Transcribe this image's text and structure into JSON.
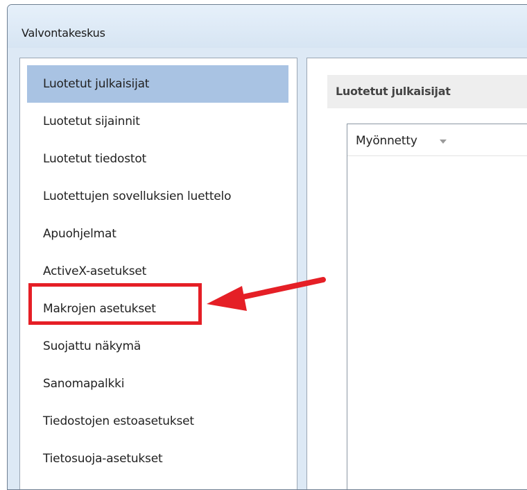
{
  "window": {
    "title": "Valvontakeskus"
  },
  "sidebar": {
    "items": [
      {
        "label": "Luotetut julkaisijat",
        "selected": true
      },
      {
        "label": "Luotetut sijainnit",
        "selected": false
      },
      {
        "label": "Luotetut tiedostot",
        "selected": false
      },
      {
        "label": "Luotettujen sovelluksien luettelo",
        "selected": false
      },
      {
        "label": "Apuohjelmat",
        "selected": false
      },
      {
        "label": "ActiveX-asetukset",
        "selected": false
      },
      {
        "label": "Makrojen asetukset",
        "selected": false
      },
      {
        "label": "Suojattu näkymä",
        "selected": false
      },
      {
        "label": "Sanomapalkki",
        "selected": false
      },
      {
        "label": "Tiedostojen estoasetukset",
        "selected": false
      },
      {
        "label": "Tietosuoja-asetukset",
        "selected": false
      }
    ]
  },
  "main": {
    "section_title": "Luotetut julkaisijat",
    "list": {
      "column_header": "Myönnetty",
      "sort_icon": "sort-down-icon"
    }
  },
  "annotation": {
    "highlight_color": "#e51f26",
    "highlighted_item": "Makrojen asetukset",
    "arrow_icon": "red-arrow-icon"
  },
  "colors": {
    "window_bg": "#dde9f5",
    "selected_bg": "#a9c3e3",
    "header_bg": "#eeeeee"
  }
}
